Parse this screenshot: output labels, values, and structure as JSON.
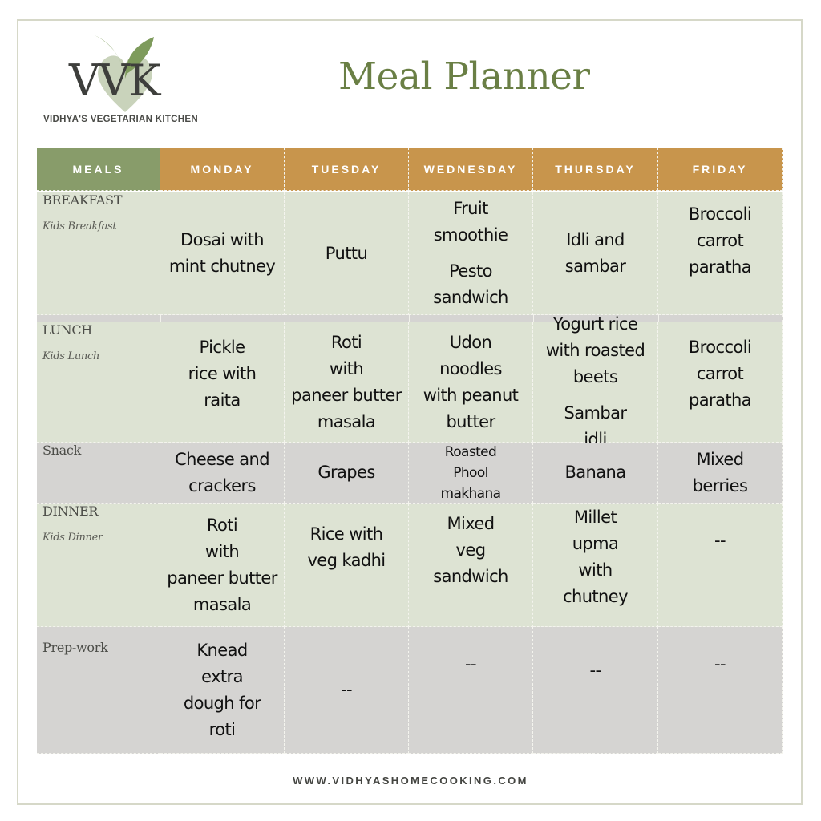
{
  "logo": {
    "mark": "VVK",
    "tagline": "VIDHYA'S VEGETARIAN KITCHEN",
    "icon": "leaf-heart-icon"
  },
  "title": "Meal Planner",
  "colors": {
    "header_meals": "#889c6a",
    "header_days": "#c8954c",
    "row_green": "#dde3d3",
    "row_grey": "#d5d4d2",
    "title": "#6a7f45"
  },
  "table": {
    "headers": [
      "MEALS",
      "MONDAY",
      "TUESDAY",
      "WEDNESDAY",
      "THURSDAY",
      "FRIDAY"
    ],
    "rows": [
      {
        "label": "BREAKFAST",
        "sublabel": "Kids Breakfast",
        "cells": [
          "Dosai with\nmint chutney",
          "Puttu",
          "Fruit\nsmoothie|Pesto\nsandwich",
          "Idli and\nsambar",
          "Broccoli\ncarrot\nparatha"
        ]
      },
      {
        "label": "LUNCH",
        "sublabel": "Kids Lunch",
        "cells": [
          "Pickle\nrice with\nraita",
          "Roti\nwith\npaneer butter\nmasala",
          "Udon\nnoodles\nwith peanut\nbutter",
          "Yogurt rice\nwith roasted\nbeets|Sambar\nidli",
          "Broccoli\ncarrot\nparatha"
        ]
      },
      {
        "label": "Snack",
        "sublabel": "",
        "cells": [
          "Cheese and\ncrackers",
          "Grapes",
          "Roasted\nPhool\nmakhana",
          "Banana",
          "Mixed\nberries"
        ]
      },
      {
        "label": "DINNER",
        "sublabel": "Kids Dinner",
        "cells": [
          "Roti\nwith\npaneer butter\nmasala",
          "Rice with\nveg kadhi",
          "Mixed\nveg\nsandwich",
          "Millet\nupma\nwith\nchutney",
          "--"
        ]
      },
      {
        "label": "Prep-work",
        "sublabel": "",
        "cells": [
          "Knead\nextra\ndough for\nroti",
          "--",
          "--",
          "--",
          "--"
        ]
      }
    ]
  },
  "footer": "WWW.VIDHYASHOMECOOKING.COM"
}
